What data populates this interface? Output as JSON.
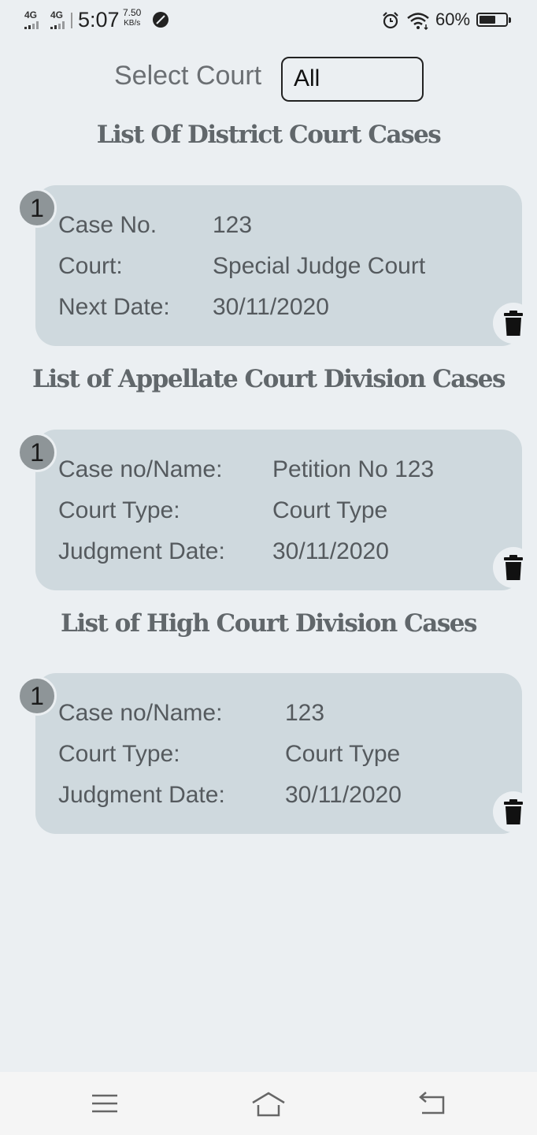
{
  "status_bar": {
    "network1": "4G",
    "network2": "4G",
    "time": "5:07",
    "speed_value": "7.50",
    "speed_unit": "KB/s",
    "battery_percent": "60%",
    "icons": [
      "signal-icon",
      "signal-icon",
      "leaf-icon",
      "alarm-icon",
      "wifi-icon",
      "battery-icon"
    ]
  },
  "filter": {
    "label": "Select Court",
    "selected": "All"
  },
  "sections": [
    {
      "title": "List Of District Court Cases",
      "cards": [
        {
          "index": "1",
          "rows": [
            {
              "label": "Case No.",
              "value": "123"
            },
            {
              "label": "Court:",
              "value": "Special Judge Court"
            },
            {
              "label": "Next Date:",
              "value": "30/11/2020"
            }
          ]
        }
      ]
    },
    {
      "title": "List of Appellate Court Division Cases",
      "cards": [
        {
          "index": "1",
          "rows": [
            {
              "label": "Case no/Name:",
              "value": "Petition No 123"
            },
            {
              "label": "Court Type:",
              "value": "Court Type"
            },
            {
              "label": "Judgment Date:",
              "value": "30/11/2020"
            }
          ]
        }
      ]
    },
    {
      "title": "List of High Court Division Cases",
      "cards": [
        {
          "index": "1",
          "rows": [
            {
              "label": "Case no/Name:",
              "value": "123"
            },
            {
              "label": "Court Type:",
              "value": "Court Type"
            },
            {
              "label": "Judgment Date:",
              "value": "30/11/2020"
            }
          ]
        }
      ]
    }
  ],
  "nav_bar": {
    "icons": [
      "menu-icon",
      "home-icon",
      "back-icon"
    ]
  },
  "colors": {
    "background": "#ebeff2",
    "card": "#cfd9de",
    "badge": "#8e9598",
    "title": "#61676b"
  }
}
